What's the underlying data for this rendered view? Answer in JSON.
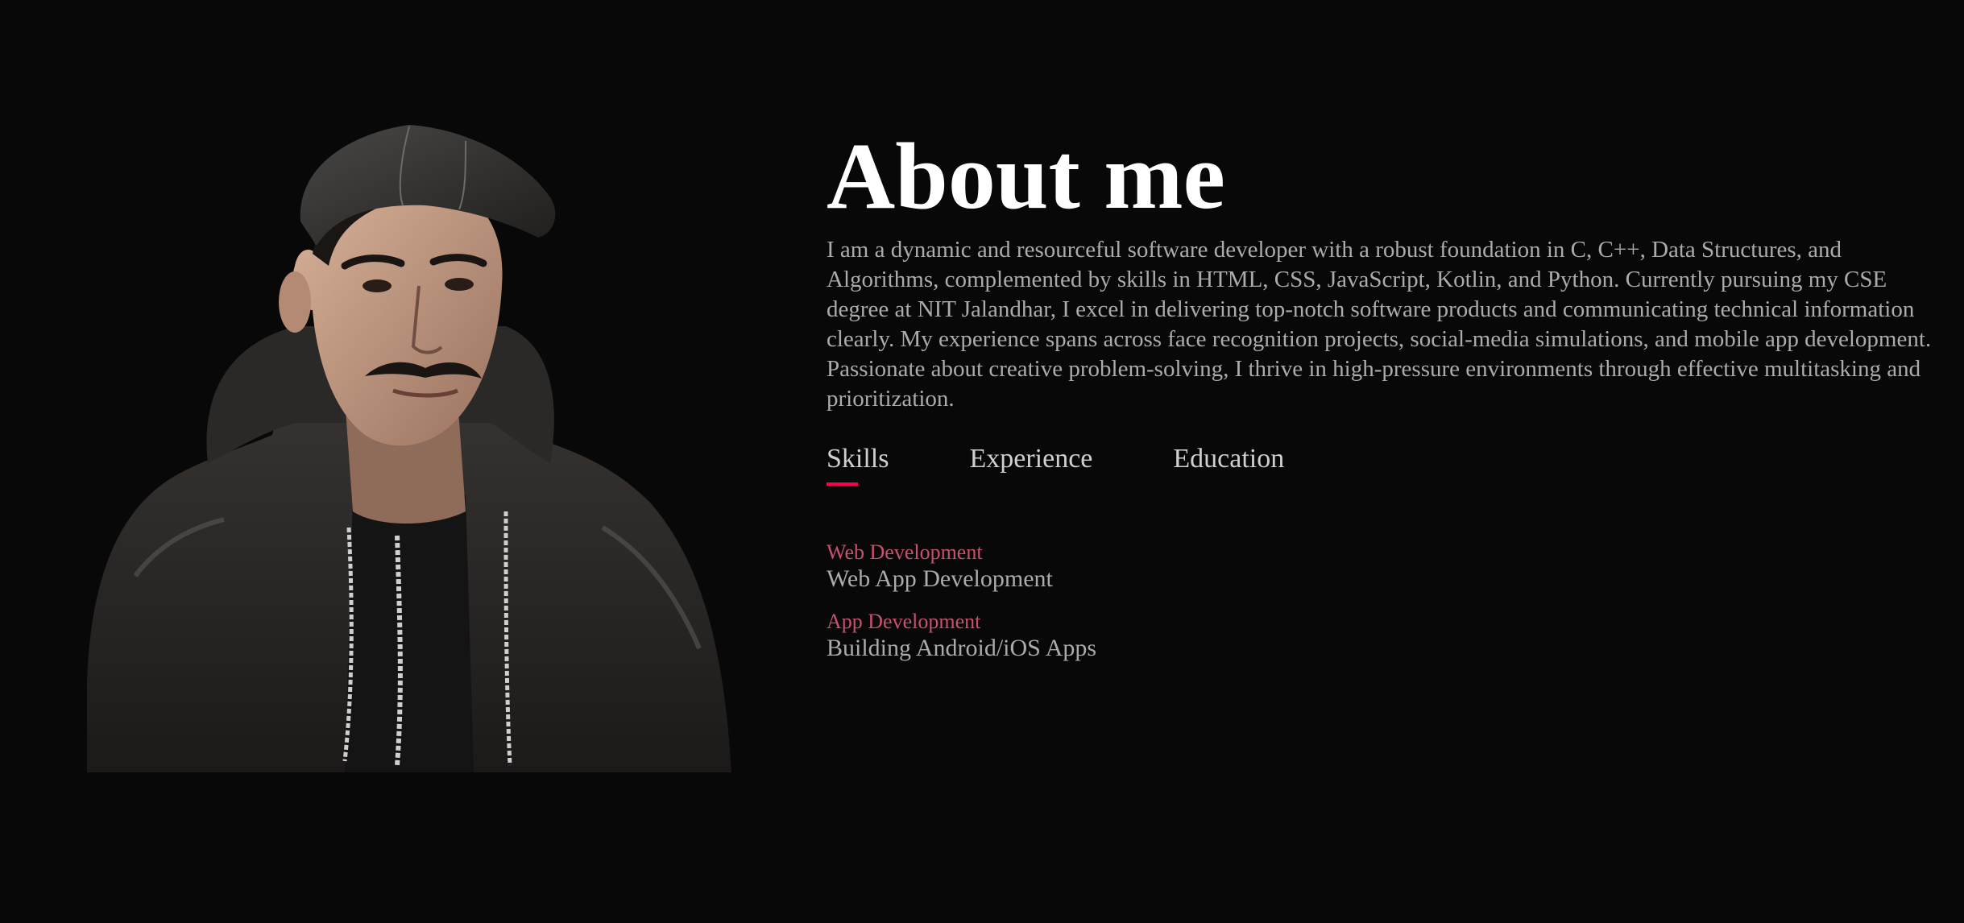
{
  "about": {
    "title": "About me",
    "description": "I am a dynamic and resourceful software developer with a robust foundation in C, C++, Data Structures, and Algorithms, complemented by skills in HTML, CSS, JavaScript, Kotlin, and Python. Currently pursuing my CSE degree at NIT Jalandhar, I excel in delivering top-notch software products and communicating technical information clearly. My experience spans across face recognition projects, social-media simulations, and mobile app development. Passionate about creative problem-solving, I thrive in high-pressure environments through effective multitasking and prioritization."
  },
  "tabs": [
    {
      "label": "Skills",
      "active": true
    },
    {
      "label": "Experience",
      "active": false
    },
    {
      "label": "Education",
      "active": false
    }
  ],
  "skills": [
    {
      "category": "Web Development",
      "detail": "Web App Development"
    },
    {
      "category": "App Development",
      "detail": "Building Android/iOS Apps"
    }
  ],
  "colors": {
    "background": "#080808",
    "accent": "#ff004f",
    "category_text": "#c9506e",
    "body_text": "#ababab",
    "title_text": "#ffffff"
  },
  "portrait": {
    "icon": "person-photo-icon"
  }
}
